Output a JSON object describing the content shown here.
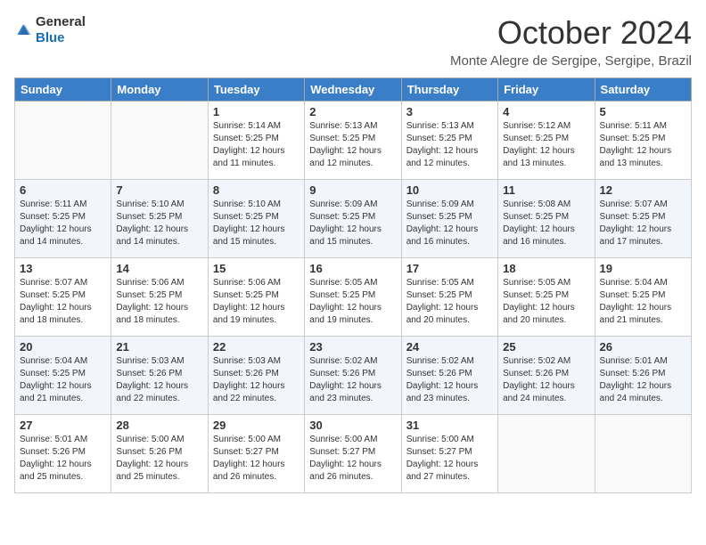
{
  "logo": {
    "text_general": "General",
    "text_blue": "Blue"
  },
  "title": "October 2024",
  "location": "Monte Alegre de Sergipe, Sergipe, Brazil",
  "headers": [
    "Sunday",
    "Monday",
    "Tuesday",
    "Wednesday",
    "Thursday",
    "Friday",
    "Saturday"
  ],
  "weeks": [
    [
      {
        "day": "",
        "text": ""
      },
      {
        "day": "",
        "text": ""
      },
      {
        "day": "1",
        "text": "Sunrise: 5:14 AM\nSunset: 5:25 PM\nDaylight: 12 hours and 11 minutes."
      },
      {
        "day": "2",
        "text": "Sunrise: 5:13 AM\nSunset: 5:25 PM\nDaylight: 12 hours and 12 minutes."
      },
      {
        "day": "3",
        "text": "Sunrise: 5:13 AM\nSunset: 5:25 PM\nDaylight: 12 hours and 12 minutes."
      },
      {
        "day": "4",
        "text": "Sunrise: 5:12 AM\nSunset: 5:25 PM\nDaylight: 12 hours and 13 minutes."
      },
      {
        "day": "5",
        "text": "Sunrise: 5:11 AM\nSunset: 5:25 PM\nDaylight: 12 hours and 13 minutes."
      }
    ],
    [
      {
        "day": "6",
        "text": "Sunrise: 5:11 AM\nSunset: 5:25 PM\nDaylight: 12 hours and 14 minutes."
      },
      {
        "day": "7",
        "text": "Sunrise: 5:10 AM\nSunset: 5:25 PM\nDaylight: 12 hours and 14 minutes."
      },
      {
        "day": "8",
        "text": "Sunrise: 5:10 AM\nSunset: 5:25 PM\nDaylight: 12 hours and 15 minutes."
      },
      {
        "day": "9",
        "text": "Sunrise: 5:09 AM\nSunset: 5:25 PM\nDaylight: 12 hours and 15 minutes."
      },
      {
        "day": "10",
        "text": "Sunrise: 5:09 AM\nSunset: 5:25 PM\nDaylight: 12 hours and 16 minutes."
      },
      {
        "day": "11",
        "text": "Sunrise: 5:08 AM\nSunset: 5:25 PM\nDaylight: 12 hours and 16 minutes."
      },
      {
        "day": "12",
        "text": "Sunrise: 5:07 AM\nSunset: 5:25 PM\nDaylight: 12 hours and 17 minutes."
      }
    ],
    [
      {
        "day": "13",
        "text": "Sunrise: 5:07 AM\nSunset: 5:25 PM\nDaylight: 12 hours and 18 minutes."
      },
      {
        "day": "14",
        "text": "Sunrise: 5:06 AM\nSunset: 5:25 PM\nDaylight: 12 hours and 18 minutes."
      },
      {
        "day": "15",
        "text": "Sunrise: 5:06 AM\nSunset: 5:25 PM\nDaylight: 12 hours and 19 minutes."
      },
      {
        "day": "16",
        "text": "Sunrise: 5:05 AM\nSunset: 5:25 PM\nDaylight: 12 hours and 19 minutes."
      },
      {
        "day": "17",
        "text": "Sunrise: 5:05 AM\nSunset: 5:25 PM\nDaylight: 12 hours and 20 minutes."
      },
      {
        "day": "18",
        "text": "Sunrise: 5:05 AM\nSunset: 5:25 PM\nDaylight: 12 hours and 20 minutes."
      },
      {
        "day": "19",
        "text": "Sunrise: 5:04 AM\nSunset: 5:25 PM\nDaylight: 12 hours and 21 minutes."
      }
    ],
    [
      {
        "day": "20",
        "text": "Sunrise: 5:04 AM\nSunset: 5:25 PM\nDaylight: 12 hours and 21 minutes."
      },
      {
        "day": "21",
        "text": "Sunrise: 5:03 AM\nSunset: 5:26 PM\nDaylight: 12 hours and 22 minutes."
      },
      {
        "day": "22",
        "text": "Sunrise: 5:03 AM\nSunset: 5:26 PM\nDaylight: 12 hours and 22 minutes."
      },
      {
        "day": "23",
        "text": "Sunrise: 5:02 AM\nSunset: 5:26 PM\nDaylight: 12 hours and 23 minutes."
      },
      {
        "day": "24",
        "text": "Sunrise: 5:02 AM\nSunset: 5:26 PM\nDaylight: 12 hours and 23 minutes."
      },
      {
        "day": "25",
        "text": "Sunrise: 5:02 AM\nSunset: 5:26 PM\nDaylight: 12 hours and 24 minutes."
      },
      {
        "day": "26",
        "text": "Sunrise: 5:01 AM\nSunset: 5:26 PM\nDaylight: 12 hours and 24 minutes."
      }
    ],
    [
      {
        "day": "27",
        "text": "Sunrise: 5:01 AM\nSunset: 5:26 PM\nDaylight: 12 hours and 25 minutes."
      },
      {
        "day": "28",
        "text": "Sunrise: 5:00 AM\nSunset: 5:26 PM\nDaylight: 12 hours and 25 minutes."
      },
      {
        "day": "29",
        "text": "Sunrise: 5:00 AM\nSunset: 5:27 PM\nDaylight: 12 hours and 26 minutes."
      },
      {
        "day": "30",
        "text": "Sunrise: 5:00 AM\nSunset: 5:27 PM\nDaylight: 12 hours and 26 minutes."
      },
      {
        "day": "31",
        "text": "Sunrise: 5:00 AM\nSunset: 5:27 PM\nDaylight: 12 hours and 27 minutes."
      },
      {
        "day": "",
        "text": ""
      },
      {
        "day": "",
        "text": ""
      }
    ]
  ]
}
